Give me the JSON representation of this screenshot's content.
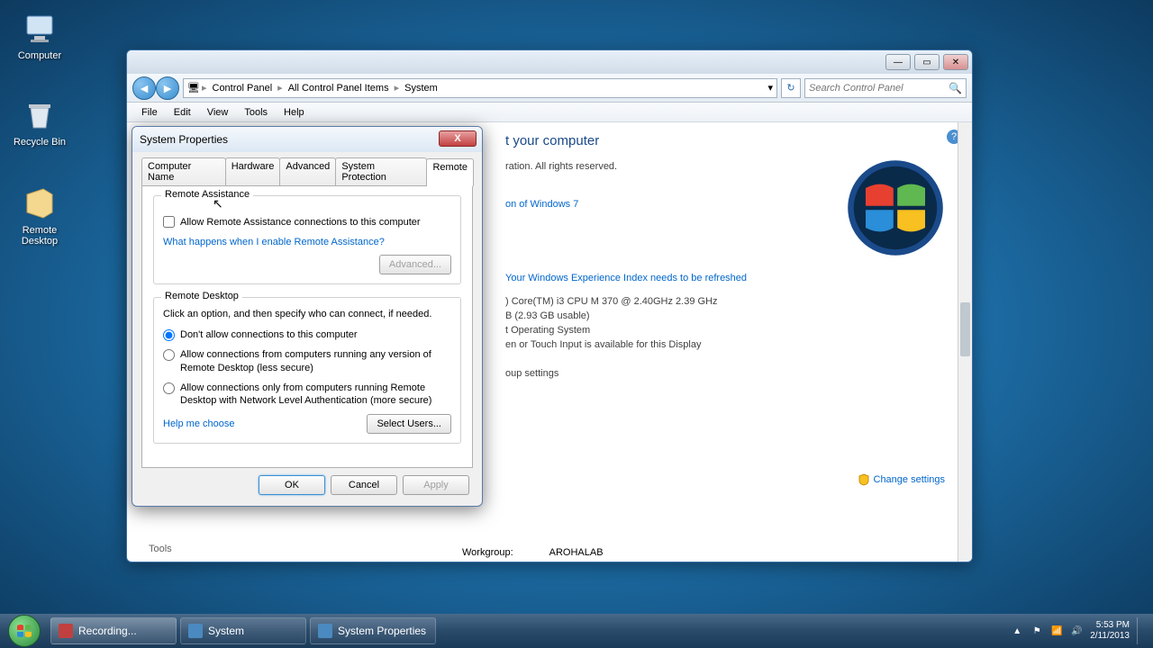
{
  "desktop": {
    "icons": [
      {
        "label": "Computer"
      },
      {
        "label": "Recycle Bin"
      },
      {
        "label": "Remote Desktop"
      }
    ]
  },
  "explorer": {
    "breadcrumb": [
      "Control Panel",
      "All Control Panel Items",
      "System"
    ],
    "search_placeholder": "Search Control Panel",
    "menu": [
      "File",
      "Edit",
      "View",
      "Tools",
      "Help"
    ],
    "header": "t your computer",
    "line_rights": "ration.  All rights reserved.",
    "line_edition": "on of Windows 7",
    "line_experience": "Your Windows Experience Index needs to be refreshed",
    "line_cpu": ") Core(TM) i3 CPU       M 370  @ 2.40GHz   2.39 GHz",
    "line_ram": "B (2.93 GB usable)",
    "line_os": "t Operating System",
    "line_pen": "en or Touch Input is available for this Display",
    "line_group": "oup settings",
    "change_settings": "Change settings",
    "tools": "Tools",
    "workgroup_label": "Workgroup:",
    "workgroup_value": "AROHALAB"
  },
  "dialog": {
    "title": "System Properties",
    "tabs": [
      "Computer Name",
      "Hardware",
      "Advanced",
      "System Protection",
      "Remote"
    ],
    "active_tab": "Remote",
    "ra": {
      "legend": "Remote Assistance",
      "checkbox": "Allow Remote Assistance connections to this computer",
      "link": "What happens when I enable Remote Assistance?",
      "advanced_btn": "Advanced..."
    },
    "rd": {
      "legend": "Remote Desktop",
      "instruction": "Click an option, and then specify who can connect, if needed.",
      "opt1": "Don't allow connections to this computer",
      "opt2": "Allow connections from computers running any version of Remote Desktop (less secure)",
      "opt3": "Allow connections only from computers running Remote Desktop with Network Level Authentication (more secure)",
      "help_link": "Help me choose",
      "select_users": "Select Users..."
    },
    "buttons": {
      "ok": "OK",
      "cancel": "Cancel",
      "apply": "Apply"
    }
  },
  "taskbar": {
    "tasks": [
      "Recording...",
      "System",
      "System Properties"
    ],
    "time": "5:53 PM",
    "date": "2/11/2013"
  }
}
